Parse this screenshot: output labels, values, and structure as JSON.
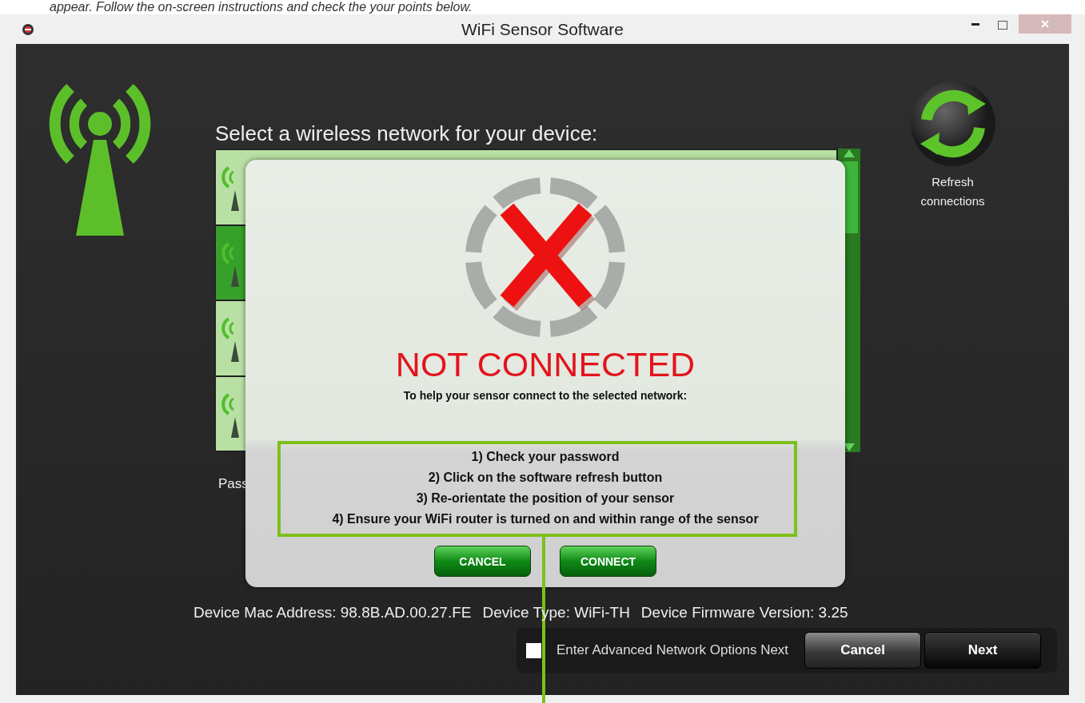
{
  "caption": "appear. Follow the on-screen instructions and check the your points below.",
  "window": {
    "title": "WiFi Sensor Software"
  },
  "heading": "Select a wireless network for your device:",
  "networks": [
    {
      "selected": false
    },
    {
      "selected": true
    },
    {
      "selected": false
    },
    {
      "selected": false
    }
  ],
  "refresh": {
    "label": "Refresh connections"
  },
  "password": {
    "label": "Pass"
  },
  "dialog": {
    "status": "NOT CONNECTED",
    "intro": "To help your sensor connect to the selected network:",
    "steps": [
      "1) Check your password",
      "2) Click on the software refresh button",
      "3) Re-orientate the position of your sensor",
      "4) Ensure your WiFi router is turned on and within range of the sensor"
    ],
    "buttons": [
      "CANCEL",
      "CONNECT"
    ]
  },
  "device_info": [
    "Device Mac Address: 98.8B.AD.00.27.FE",
    "Device Type: WiFi-TH",
    "Device Firmware Version: 3.25"
  ],
  "advanced": {
    "label": "Enter Advanced Network Options Next",
    "checked": false
  },
  "buttons": [
    "Cancel",
    "Next"
  ]
}
